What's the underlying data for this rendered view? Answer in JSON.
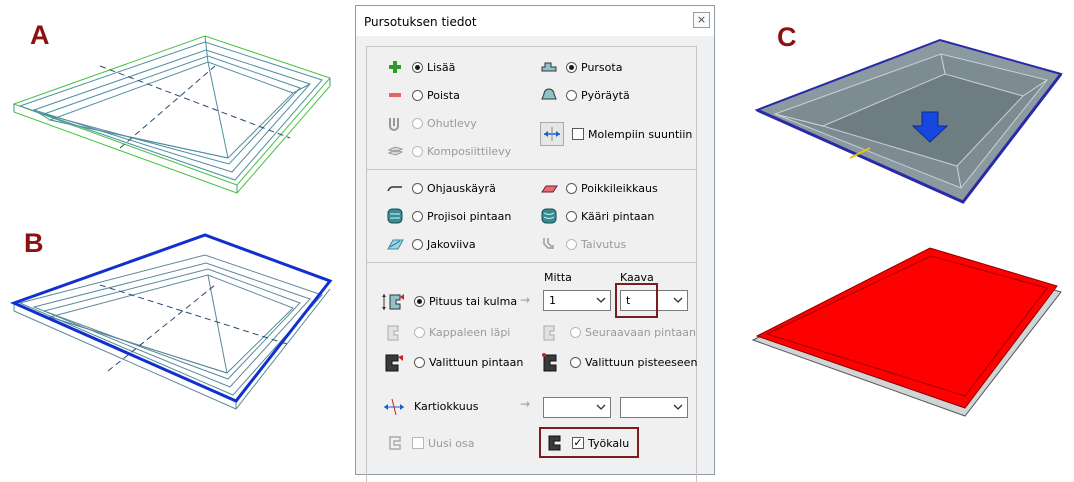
{
  "panel_labels": {
    "a": "A",
    "b": "B",
    "c": "C"
  },
  "dialog": {
    "title": "Pursotuksen tiedot",
    "close": "×",
    "operation": {
      "add": "Lisää",
      "remove": "Poista",
      "thin_sheet": "Ohutlevy",
      "composite_sheet": "Komposiittilevy",
      "extrude": "Pursota",
      "revolve": "Pyöräytä",
      "both_directions": "Molempiin suuntiin"
    },
    "profile": {
      "guide_curve": "Ohjauskäyrä",
      "cross_section": "Poikkileikkaus",
      "project_to_surface": "Projisoi pintaan",
      "wrap_to_surface": "Kääri pintaan",
      "split_line": "Jakoviiva",
      "bend": "Taivutus"
    },
    "extent": {
      "col_dimension": "Mitta",
      "col_formula": "Kaava",
      "length_or_angle": "Pituus tai kulma",
      "dimension_value": "1",
      "formula_value": "t",
      "through_part": "Kappaleen läpi",
      "next_surface": "Seuraavaan pintaan",
      "to_selected_surface": "Valittuun pintaan",
      "to_selected_point": "Valittuun pisteeseen",
      "taper": "Kartiokkuus",
      "new_part": "Uusi osa",
      "tool": "Työkalu",
      "arrow": "→"
    }
  },
  "colors": {
    "label_red": "#8a1212",
    "highlight": "#7d1c1c",
    "fill_red": "#ff0000",
    "edge_blue": "#1030d0",
    "wire": "#5a8a9a"
  }
}
